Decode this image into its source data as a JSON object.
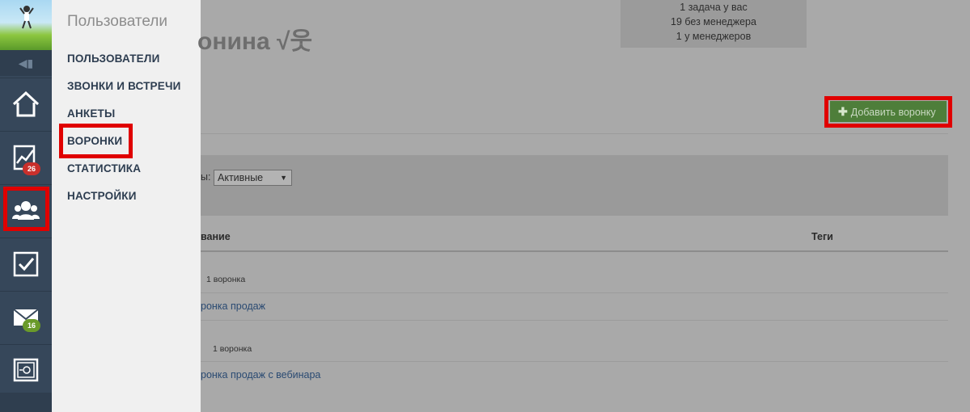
{
  "rail": {
    "items": [
      {
        "name": "home",
        "icon": "home-icon"
      },
      {
        "name": "stats",
        "icon": "chart-icon",
        "badge": "26",
        "badge_color": "#c9302c"
      },
      {
        "name": "users",
        "icon": "users-icon"
      },
      {
        "name": "tasks",
        "icon": "checkbox-icon"
      },
      {
        "name": "mail",
        "icon": "mail-icon",
        "badge": "16",
        "badge_color": "#6a9a2a"
      },
      {
        "name": "settings",
        "icon": "safe-icon"
      }
    ]
  },
  "flyout": {
    "title": "Пользователи",
    "items": [
      "ПОЛЬЗОВАТЕЛИ",
      "ЗВОНКИ И ВСТРЕЧИ",
      "АНКЕТЫ",
      "ВОРОНКИ",
      "СТАТИСТИКА",
      "НАСТРОЙКИ"
    ]
  },
  "main": {
    "title_fragment": "онина √웃",
    "stats": [
      "1 задача у вас",
      "19 без менеджера",
      "1 у менеджеров"
    ],
    "add_button": {
      "icon": "plus-icon",
      "label": "Добавить воронку"
    },
    "filter": {
      "label_fragment": "ы:",
      "value": "Активные"
    },
    "table": {
      "headers": {
        "name": "вание",
        "tags": "Теги"
      },
      "rows": [
        {
          "count": "1 воронка",
          "link": "ронка продаж"
        },
        {
          "count": "1 воронка",
          "link": "ронка продаж с вебинара"
        }
      ]
    }
  },
  "colors": {
    "highlight": "#e00000",
    "rail": "#36475a",
    "button": "#4e7e3a"
  }
}
